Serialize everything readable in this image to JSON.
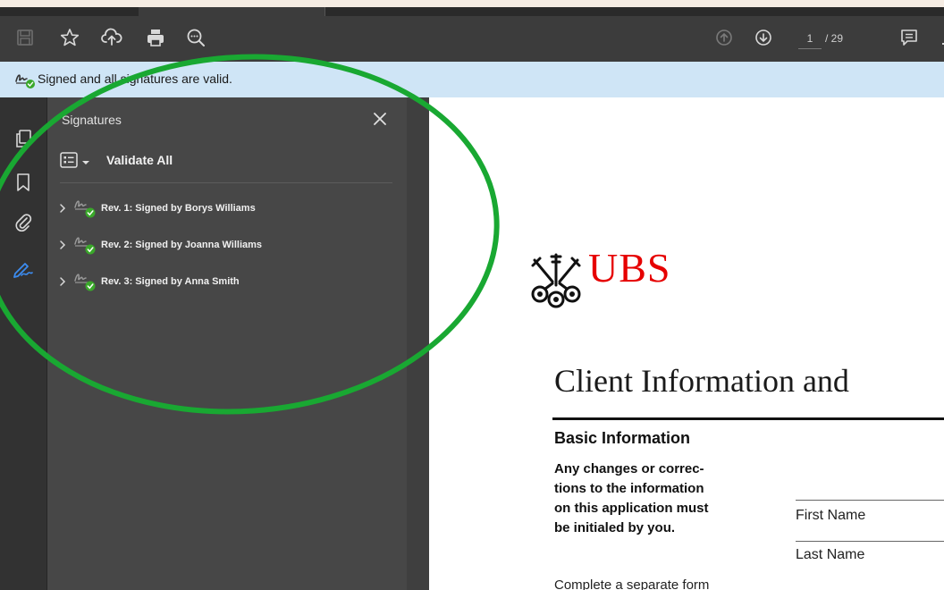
{
  "toolbar": {
    "icons": [
      "save-icon",
      "star-icon",
      "upload-icon",
      "print-icon",
      "zoom-search-icon",
      "page-up-icon",
      "page-down-icon",
      "comment-icon"
    ],
    "current_page": "1",
    "total_pages": "/ 29"
  },
  "signature_bar": {
    "message": "Signed and all signatures are valid."
  },
  "left_rail": {
    "icons": [
      "pages-icon",
      "bookmark-icon",
      "attachment-icon",
      "signature-panel-icon"
    ]
  },
  "signatures_panel": {
    "title": "Signatures",
    "validate_all": "Validate All",
    "revisions": [
      {
        "label": "Rev. 1: Signed by Borys Williams"
      },
      {
        "label": "Rev. 2: Signed by Joanna Williams"
      },
      {
        "label": "Rev. 3: Signed by Anna Smith"
      }
    ]
  },
  "document": {
    "brand": "UBS",
    "heading": "Client Information and",
    "section_title": "Basic Information",
    "notice_lines": [
      "Any changes or correc-",
      "tions to the information",
      "on this application must",
      "be initialed by you."
    ],
    "trailing_text": "Complete a separate form",
    "fields": [
      {
        "label": "First Name"
      },
      {
        "label": "Last Name"
      }
    ]
  },
  "colors": {
    "brand_red": "#e60000",
    "valid_green": "#3aa82a",
    "signature_bar": "#cfe5f6",
    "highlight_circle": "#19a832",
    "active_rail_icon": "#3c8cf0"
  }
}
